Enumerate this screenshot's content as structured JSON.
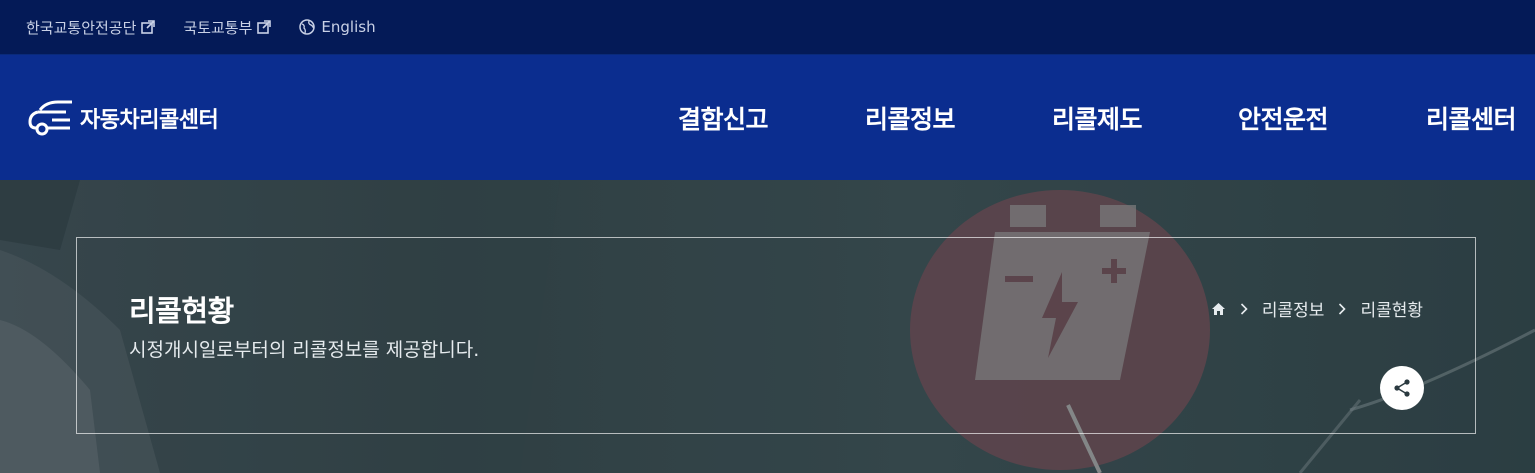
{
  "topbar": {
    "links": [
      {
        "label": "한국교통안전공단",
        "icon": "external-link-icon"
      },
      {
        "label": "국토교통부",
        "icon": "external-link-icon"
      },
      {
        "label": "English",
        "icon": "globe-icon"
      }
    ]
  },
  "header": {
    "logo_text": "자동차리콜센터",
    "logo_icon": "car-logo-icon",
    "nav": [
      {
        "label": "결함신고"
      },
      {
        "label": "리콜정보"
      },
      {
        "label": "리콜제도"
      },
      {
        "label": "안전운전"
      },
      {
        "label": "리콜센터"
      }
    ]
  },
  "hero": {
    "title": "리콜현황",
    "description": "시정개시일로부터의 리콜정보를 제공합니다.",
    "breadcrumb": {
      "home_icon": "home-icon",
      "items": [
        "리콜정보",
        "리콜현황"
      ]
    },
    "share_icon": "share-icon"
  },
  "colors": {
    "topbar_bg": "#041a57",
    "header_bg": "#0b2d8f",
    "hero_bg": "#3a4a4f",
    "white": "#ffffff"
  }
}
